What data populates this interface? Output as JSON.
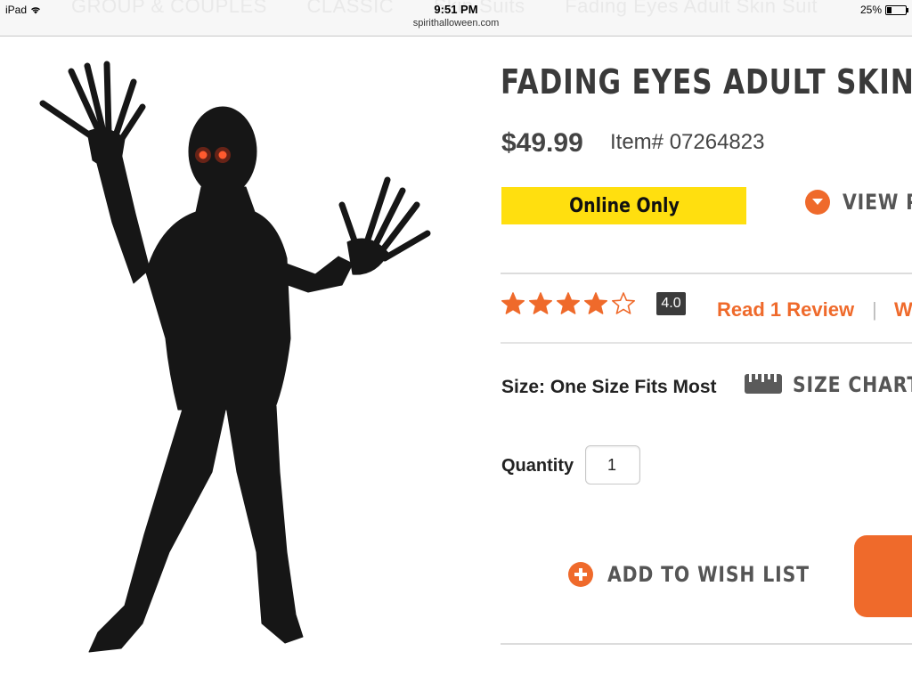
{
  "status_bar": {
    "device": "iPad",
    "time": "9:51 PM",
    "url": "spirithalloween.com",
    "battery": "25%",
    "battery_level": 0.25
  },
  "breadcrumb_ghost": [
    "GROUP & COUPLES",
    "CLASSIC",
    "Skin Suits",
    "Fading Eyes Adult Skin Suit"
  ],
  "product": {
    "title": "FADING EYES ADULT SKIN",
    "price": "$49.99",
    "item_label": "Item# 07264823",
    "badge": "Online Only",
    "view_link": "VIEW PR",
    "rating_value": "4.0",
    "rating_stars": 4,
    "rating_max": 5,
    "review_link": "Read 1 Review",
    "separator": "|",
    "write_link": "W",
    "size_text": "Size: One Size Fits Most",
    "size_chart": "SIZE CHART",
    "quantity_label": "Quantity",
    "quantity_value": "1",
    "wishlist": "ADD TO WISH LIST"
  },
  "colors": {
    "accent": "#ef6a2b",
    "badge_yellow": "#ffdf0f",
    "heading": "#3a3a3a",
    "eye_glow": "#ff3b1a"
  },
  "icons": {
    "wifi": "wifi-icon",
    "battery": "battery-icon",
    "view": "chevron-down-circle-icon",
    "star_full": "star-filled-icon",
    "star_empty": "star-outline-icon",
    "ruler": "ruler-icon",
    "add": "plus-circle-icon"
  }
}
